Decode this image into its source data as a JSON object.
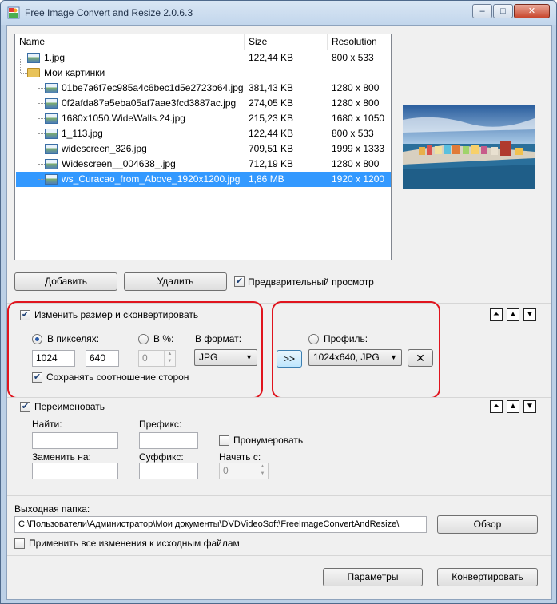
{
  "window": {
    "title": "Free Image Convert and Resize 2.0.6.3",
    "buttons": [
      "–",
      "□",
      "✕"
    ]
  },
  "file_list": {
    "columns": [
      "Name",
      "Size",
      "Resolution"
    ],
    "rows": [
      {
        "name": "1.jpg",
        "size": "122,44 KB",
        "resolution": "800 x 533",
        "level": 1,
        "kind": "file",
        "selected": false
      },
      {
        "name": "Мои картинки",
        "size": "",
        "resolution": "",
        "level": 0,
        "kind": "folder",
        "selected": false
      },
      {
        "name": "01be7a6f7ec985a4c6bec1d5e2723b64.jpg",
        "size": "381,43 KB",
        "resolution": "1280 x 800",
        "level": 2,
        "kind": "file",
        "selected": false
      },
      {
        "name": "0f2afda87a5eba05af7aae3fcd3887ac.jpg",
        "size": "274,05 KB",
        "resolution": "1280 x 800",
        "level": 2,
        "kind": "file",
        "selected": false
      },
      {
        "name": "1680x1050.WideWalls.24.jpg",
        "size": "215,23 KB",
        "resolution": "1680 x 1050",
        "level": 2,
        "kind": "file",
        "selected": false
      },
      {
        "name": "1_113.jpg",
        "size": "122,44 KB",
        "resolution": "800 x 533",
        "level": 2,
        "kind": "file",
        "selected": false
      },
      {
        "name": "widescreen_326.jpg",
        "size": "709,51 KB",
        "resolution": "1999 x 1333",
        "level": 2,
        "kind": "file",
        "selected": false
      },
      {
        "name": "Widescreen__004638_.jpg",
        "size": "712,19 KB",
        "resolution": "1280 x 800",
        "level": 2,
        "kind": "file",
        "selected": false
      },
      {
        "name": "ws_Curacao_from_Above_1920x1200.jpg",
        "size": "1,86 MB",
        "resolution": "1920 x 1200",
        "level": 2,
        "kind": "file",
        "selected": true
      }
    ]
  },
  "list_buttons": {
    "add": "Добавить",
    "remove": "Удалить",
    "preview_label": "Предварительный просмотр",
    "preview_checked": true
  },
  "resize": {
    "enable_label": "Изменить размер и сконвертировать",
    "enabled": true,
    "pixels_label": "В пикселях:",
    "width": "1024",
    "height": "640",
    "percent_label": "В %:",
    "percent_value": "0",
    "format_label": "В формат:",
    "format_value": "JPG",
    "keep_ratio_label": "Сохранять соотношение сторон",
    "keep_ratio_checked": true,
    "apply_button": ">>",
    "profile_label": "Профиль:",
    "profile_value": "1024x640, JPG",
    "delete_profile_icon": "✕"
  },
  "rename": {
    "enable_label": "Переименовать",
    "enabled": true,
    "find_label": "Найти:",
    "prefix_label": "Префикс:",
    "number_label": "Пронумеровать",
    "replace_label": "Заменить на:",
    "suffix_label": "Суффикс:",
    "start_label": "Начать с:",
    "start_value": "0"
  },
  "output": {
    "label": "Выходная папка:",
    "path": "C:\\Пользователи\\Администратор\\Мои документы\\DVDVideoSoft\\FreeImageConvertAndResize\\",
    "browse": "Обзор",
    "apply_original_label": "Применить все изменения к исходным файлам"
  },
  "footer": {
    "settings": "Параметры",
    "convert": "Конвертировать"
  },
  "panel_controls": {
    "collapse_icon": "⏶",
    "up_icon": "▲",
    "down_icon": "▼"
  }
}
